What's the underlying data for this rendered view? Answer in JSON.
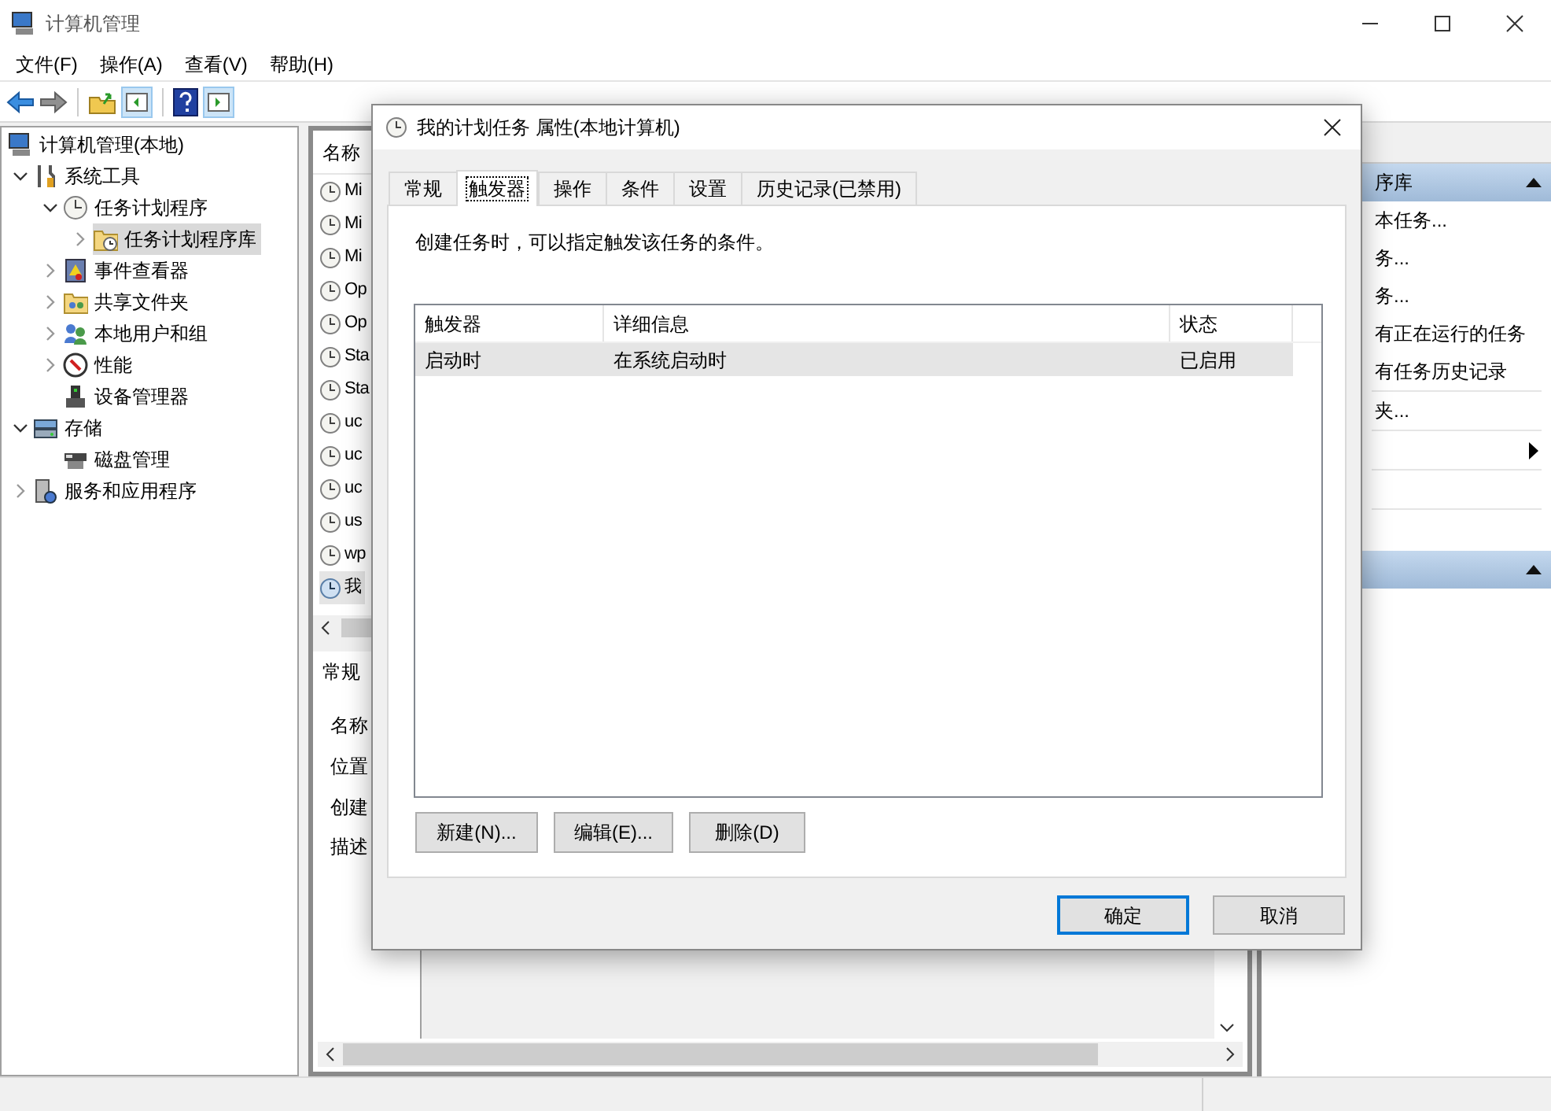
{
  "window": {
    "title": "计算机管理"
  },
  "menu": [
    "文件(F)",
    "操作(A)",
    "查看(V)",
    "帮助(H)"
  ],
  "tree": [
    {
      "label": "计算机管理(本地)",
      "selected": false,
      "children": [
        {
          "label": "系统工具",
          "expanded": true,
          "selected": false,
          "children": [
            {
              "label": "任务计划程序",
              "expanded": true,
              "selected": false,
              "children": [
                {
                  "label": "任务计划程序库",
                  "expanded": false,
                  "selected": true
                }
              ]
            },
            {
              "label": "事件查看器",
              "expanded": false,
              "selected": false
            },
            {
              "label": "共享文件夹",
              "expanded": false,
              "selected": false
            },
            {
              "label": "本地用户和组",
              "expanded": false,
              "selected": false
            },
            {
              "label": "性能",
              "expanded": false,
              "selected": false
            },
            {
              "label": "设备管理器",
              "selected": false
            }
          ]
        },
        {
          "label": "存储",
          "expanded": true,
          "selected": false,
          "children": [
            {
              "label": "磁盘管理",
              "selected": false
            }
          ]
        },
        {
          "label": "服务和应用程序",
          "expanded": false,
          "selected": false
        }
      ]
    }
  ],
  "task_list": {
    "column_1": "名称",
    "rows": [
      {
        "label": "Mi",
        "selected": false
      },
      {
        "label": "Mi",
        "selected": false
      },
      {
        "label": "Mi",
        "selected": false
      },
      {
        "label": "Op",
        "selected": false
      },
      {
        "label": "Op",
        "selected": false
      },
      {
        "label": "Sta",
        "selected": false
      },
      {
        "label": "Sta",
        "selected": false
      },
      {
        "label": "uc",
        "selected": false
      },
      {
        "label": "uc",
        "selected": false
      },
      {
        "label": "uc",
        "selected": false
      },
      {
        "label": "us",
        "selected": false
      },
      {
        "label": "wp",
        "selected": false
      },
      {
        "label": "我",
        "selected": true
      }
    ]
  },
  "detail_pane": {
    "tab": "常规",
    "labels": [
      "名称",
      "位置",
      "创建",
      "描述"
    ]
  },
  "actions": [
    {
      "title": "序库",
      "expanded": true,
      "items": [
        {
          "kind": "action",
          "label": "本任务..."
        },
        {
          "kind": "action",
          "label": "务..."
        },
        {
          "kind": "action",
          "label": "务..."
        },
        {
          "kind": "action",
          "label": "有正在运行的任务"
        },
        {
          "kind": "action",
          "label": "有任务历史记录"
        },
        {
          "kind": "separator"
        },
        {
          "kind": "action",
          "label": "夹..."
        },
        {
          "kind": "separator"
        },
        {
          "kind": "submenu"
        },
        {
          "kind": "separator"
        },
        {
          "kind": "blank"
        },
        {
          "kind": "separator"
        }
      ]
    },
    {
      "expanded": true
    }
  ],
  "dialog": {
    "title": "我的计划任务 属性(本地计算机)",
    "tabs": [
      {
        "label": "常规",
        "selected": false
      },
      {
        "label": "触发器",
        "selected": true
      },
      {
        "label": "操作",
        "selected": false
      },
      {
        "label": "条件",
        "selected": false
      },
      {
        "label": "设置",
        "selected": false
      },
      {
        "label": "历史记录(已禁用)",
        "selected": false
      }
    ],
    "description": "创建任务时，可以指定触发该任务的条件。",
    "table": {
      "columns": [
        "触发器",
        "详细信息",
        "状态"
      ],
      "rows": [
        {
          "cells": [
            "启动时",
            "在系统启动时",
            "已启用"
          ],
          "selected": true
        }
      ]
    },
    "table_buttons": [
      "新建(N)...",
      "编辑(E)...",
      "删除(D)"
    ],
    "buttons": [
      {
        "label": "确定",
        "default": true
      },
      {
        "label": "取消",
        "default": false
      }
    ]
  }
}
